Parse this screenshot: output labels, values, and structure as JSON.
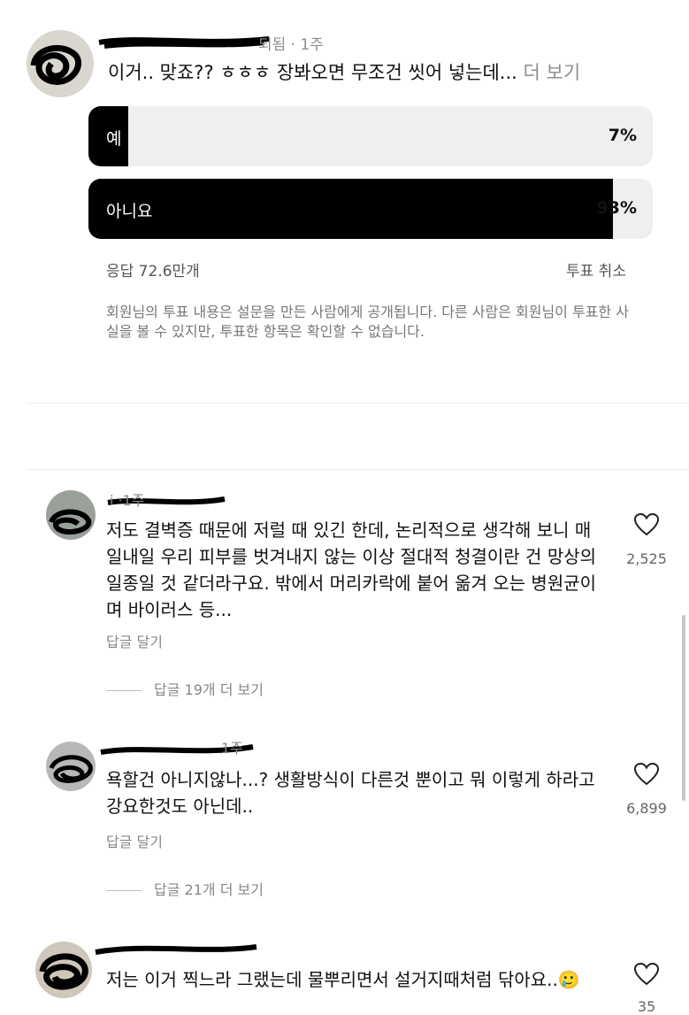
{
  "post": {
    "meta": "되됨 · 1주",
    "text": "이거.. 맞죠?? ㅎㅎㅎ 장봐오면 무조건 씻어 넣는데...",
    "more": "더 보기"
  },
  "poll": {
    "options": [
      {
        "label": "예",
        "percent_text": "7%",
        "percent": 7
      },
      {
        "label": "아니요",
        "percent_text": "93%",
        "percent": 93
      }
    ],
    "responses": "응답 72.6만개",
    "cancel": "투표 취소",
    "note": "회원님의 투표 내용은 설문을 만든 사람에게 공개됩니다. 다른 사람은 회원님이 투표한 사실을 볼 수 있지만, 투표한 항목은 확인할 수 없습니다."
  },
  "comments": [
    {
      "user": "i   ·1주",
      "text": "저도 결벽증 때문에 저럴 때 있긴 한데, 논리적으로 생각해 보니 매일내일 우리 피부를 벗겨내지 않는 이상 절대적 청결이란 건 망상의 일종일 것 같더라구요. 밖에서 머리카락에 붙어 옮겨 오는 병원균이며 바이러스 등...",
      "reply": "답글 달기",
      "view_replies": "답글 19개 더 보기",
      "likes": "2,525"
    },
    {
      "user": "1주",
      "text": "욕할건 아니지않나...? 생활방식이 다른것 뿐이고 뭐 이렇게 하라고 강요한것도 아닌데..",
      "reply": "답글 달기",
      "view_replies": "답글 21개 더 보기",
      "likes": "6,899"
    },
    {
      "user": "",
      "text": "저는 이거 찍느라 그랬는데 물뿌리면서 설거지때처럼 닦아요..🥲",
      "likes": "35"
    }
  ],
  "icons": {
    "heart": "heart-outline-icon"
  },
  "colors": {
    "poll_fill": "#000000",
    "poll_track": "#efefef",
    "muted": "#8e8e8e"
  }
}
